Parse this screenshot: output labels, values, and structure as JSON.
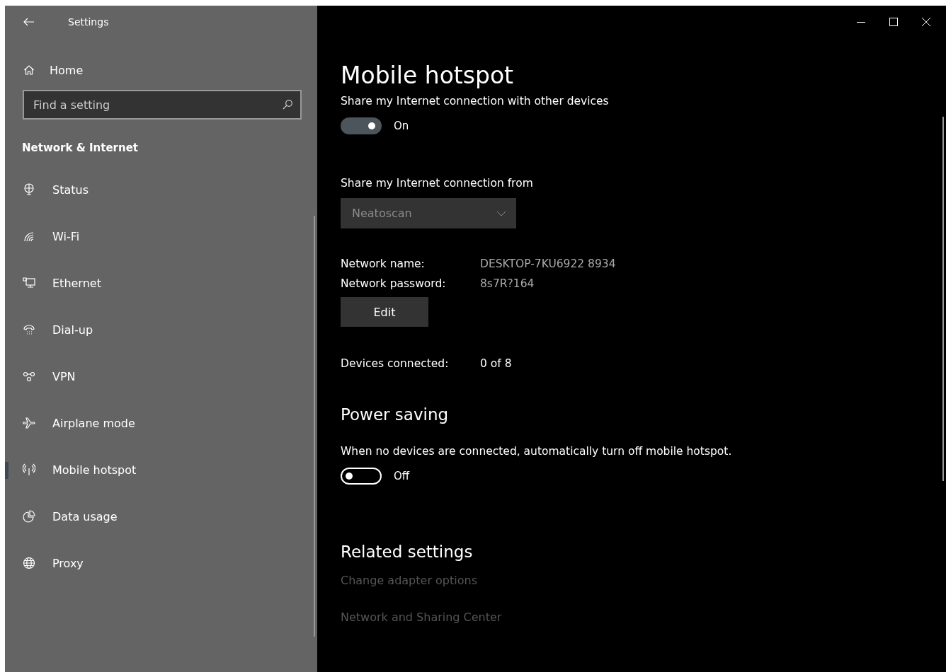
{
  "window": {
    "title": "Settings"
  },
  "sidebar": {
    "home": "Home",
    "search": {
      "placeholder": "Find a setting"
    },
    "section": "Network & Internet",
    "items": [
      {
        "label": "Status",
        "selected": false
      },
      {
        "label": "Wi-Fi",
        "selected": false
      },
      {
        "label": "Ethernet",
        "selected": false
      },
      {
        "label": "Dial-up",
        "selected": false
      },
      {
        "label": "VPN",
        "selected": false
      },
      {
        "label": "Airplane mode",
        "selected": false
      },
      {
        "label": "Mobile hotspot",
        "selected": true
      },
      {
        "label": "Data usage",
        "selected": false
      },
      {
        "label": "Proxy",
        "selected": false
      }
    ]
  },
  "page": {
    "title": "Mobile hotspot",
    "share": {
      "label": "Share my Internet connection with other devices",
      "on": true,
      "state_text": "On"
    },
    "share_from": {
      "label": "Share my Internet connection from",
      "value": "Neatoscan",
      "disabled": true
    },
    "details": [
      {
        "label": "Network name:",
        "value": "DESKTOP-7KU6922 8934"
      },
      {
        "label": "Network password:",
        "value": "8s7R?164"
      }
    ],
    "edit_button": "Edit",
    "devices": {
      "label": "Devices connected:",
      "value": "0 of 8"
    },
    "power_saving": {
      "heading": "Power saving",
      "label": "When no devices are connected, automatically turn off mobile hotspot.",
      "on": false,
      "state_text": "Off"
    },
    "related": {
      "heading": "Related settings",
      "links": [
        "Change adapter options",
        "Network and Sharing Center"
      ]
    }
  }
}
